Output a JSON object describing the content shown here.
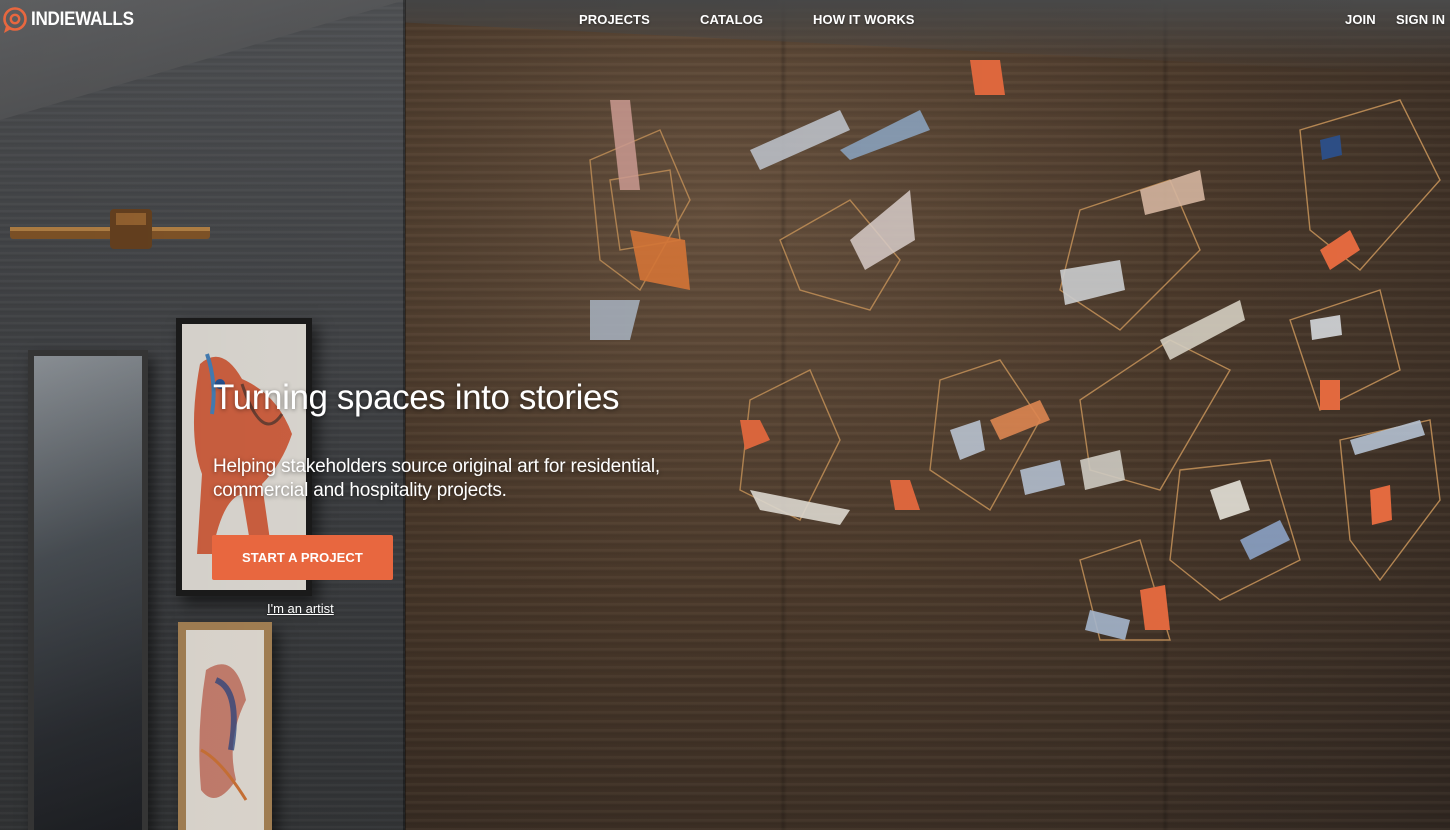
{
  "brand": {
    "name": "INDIEWALLS",
    "icon": "indiewalls-logo-icon"
  },
  "nav": {
    "links": [
      {
        "label": "PROJECTS"
      },
      {
        "label": "CATALOG"
      },
      {
        "label": "HOW IT WORKS"
      }
    ],
    "auth": {
      "join_label": "JOIN",
      "signin_label": "SIGN IN"
    }
  },
  "hero": {
    "headline": "Turning spaces into stories",
    "subheadline": "Helping stakeholders source original art for residential, commercial and hospitality projects.",
    "cta_label": "START A PROJECT",
    "artist_link_label": "I'm an artist"
  },
  "colors": {
    "accent": "#e8673f",
    "text": "#ffffff"
  }
}
